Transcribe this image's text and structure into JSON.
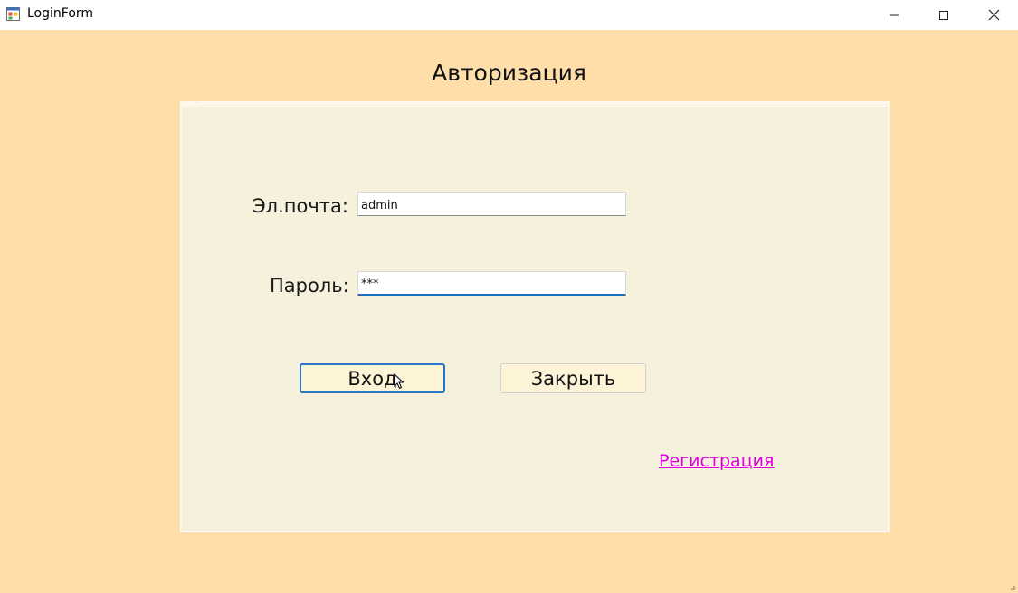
{
  "window": {
    "title": "LoginForm",
    "icon": "app-form-icon",
    "controls": [
      "minimize-icon",
      "maximize-icon",
      "close-icon"
    ]
  },
  "form": {
    "heading": "Авторизация",
    "email_label": "Эл.почта:",
    "email_value": "admin",
    "password_label": "Пароль:",
    "password_value": "***",
    "login_button": "Вход",
    "close_button": "Закрыть",
    "register_link": "Регистрация"
  },
  "colors": {
    "background": "#ffdeaa",
    "panel": "#f6f1dc",
    "button": "#fdf3d6",
    "focus_accent": "#2c74c9",
    "link": "#e000e0"
  }
}
